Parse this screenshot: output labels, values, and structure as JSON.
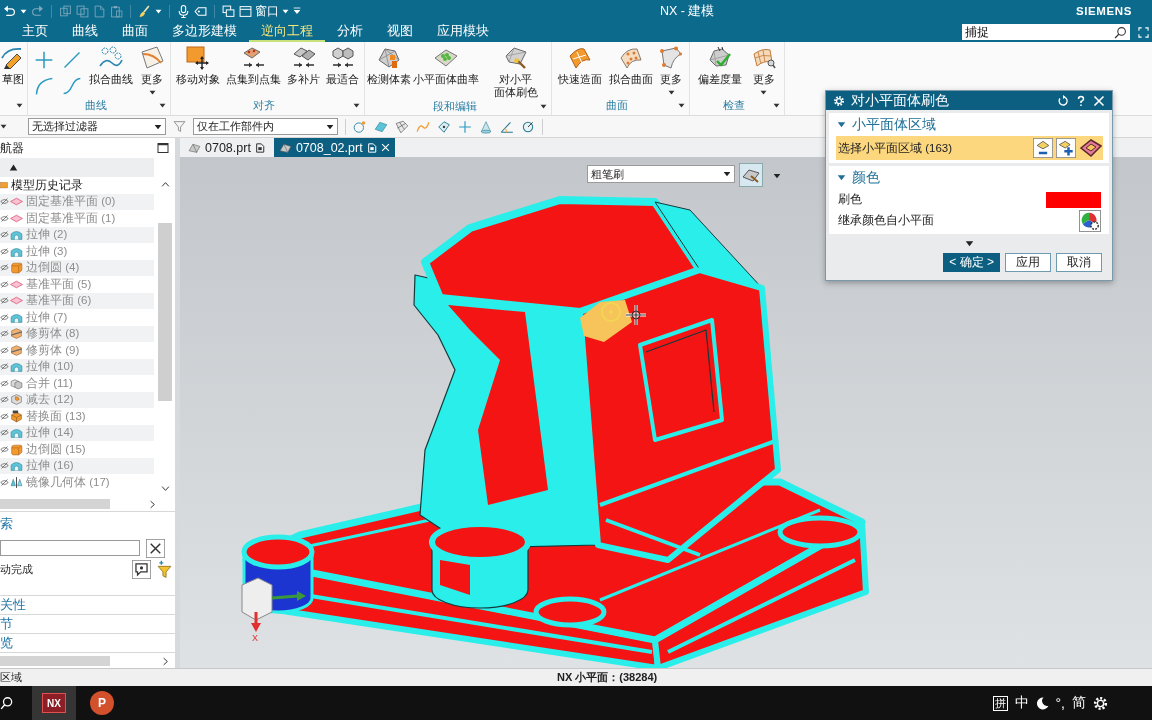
{
  "title_bar": {
    "window_menu": "窗口",
    "title": "NX - 建模",
    "brand": "SIEMENS"
  },
  "menu_tabs": [
    {
      "label": "主页",
      "selected": false
    },
    {
      "label": "曲线",
      "selected": false
    },
    {
      "label": "曲面",
      "selected": false
    },
    {
      "label": "多边形建模",
      "selected": false
    },
    {
      "label": "逆向工程",
      "selected": true
    },
    {
      "label": "分析",
      "selected": false
    },
    {
      "label": "视图",
      "selected": false
    },
    {
      "label": "应用模块",
      "selected": false
    }
  ],
  "command_search": {
    "value": "捕捉"
  },
  "ribbon": {
    "groups": [
      {
        "buttons": [
          {
            "kind": "large",
            "label": "草图"
          }
        ]
      },
      {
        "label": "曲线",
        "buttons": [
          {
            "kind": "lines"
          },
          {
            "kind": "large",
            "label": "拟合曲线"
          },
          {
            "kind": "more",
            "label": "更多"
          }
        ]
      },
      {
        "label": "对齐",
        "buttons": [
          {
            "kind": "large",
            "label": "移动对象"
          },
          {
            "kind": "large",
            "label": "点集到点集"
          },
          {
            "kind": "large",
            "label": "多补片"
          },
          {
            "kind": "large",
            "label": "最适合"
          }
        ]
      },
      {
        "label": "段和编辑",
        "buttons": [
          {
            "kind": "large",
            "label": "检测体素"
          },
          {
            "kind": "large",
            "label": "小平面体曲率"
          },
          {
            "kind": "large",
            "label": "对小平面体刷色"
          }
        ]
      },
      {
        "label": "曲面",
        "buttons": [
          {
            "kind": "large",
            "label": "快速造面"
          },
          {
            "kind": "large",
            "label": "拟合曲面"
          },
          {
            "kind": "more",
            "label": "更多"
          }
        ]
      },
      {
        "label": "检查",
        "buttons": [
          {
            "kind": "large",
            "label": "偏差度量"
          },
          {
            "kind": "more",
            "label": "更多"
          }
        ]
      }
    ]
  },
  "selection_bar": {
    "filter": "无选择过滤器",
    "scope": "仅在工作部件内"
  },
  "navigator": {
    "title": "航器",
    "root": {
      "label": "模型历史记录",
      "children": [
        {
          "kind": "datum",
          "label": "固定基准平面 (0)",
          "disabled": true
        },
        {
          "kind": "datum",
          "label": "固定基准平面 (1)",
          "disabled": true
        },
        {
          "kind": "extrude",
          "label": "拉伸 (2)",
          "disabled": true
        },
        {
          "kind": "extrude",
          "label": "拉伸 (3)",
          "disabled": true
        },
        {
          "kind": "blend",
          "label": "边倒圆 (4)",
          "disabled": true
        },
        {
          "kind": "datum",
          "label": "基准平面 (5)",
          "disabled": true
        },
        {
          "kind": "datum",
          "label": "基准平面 (6)",
          "disabled": true
        },
        {
          "kind": "extrude",
          "label": "拉伸 (7)",
          "disabled": true
        },
        {
          "kind": "trim",
          "label": "修剪体 (8)",
          "disabled": true
        },
        {
          "kind": "trim",
          "label": "修剪体 (9)",
          "disabled": true
        },
        {
          "kind": "extrude",
          "label": "拉伸 (10)",
          "disabled": true
        },
        {
          "kind": "unite",
          "label": "合并 (11)",
          "disabled": true
        },
        {
          "kind": "subtract",
          "label": "减去 (12)",
          "disabled": true
        },
        {
          "kind": "replace",
          "label": "替换面 (13)",
          "disabled": true
        },
        {
          "kind": "extrude",
          "label": "拉伸 (14)",
          "disabled": true
        },
        {
          "kind": "blend",
          "label": "边倒圆 (15)",
          "disabled": true
        },
        {
          "kind": "extrude",
          "label": "拉伸 (16)",
          "disabled": true
        },
        {
          "kind": "mirror",
          "label": "镜像几何体 (17)",
          "disabled": true
        }
      ]
    }
  },
  "search_panel": {
    "header": "索",
    "auto_complete": "动完成",
    "sections": [
      "关性",
      "节",
      "览"
    ]
  },
  "document_tabs": [
    {
      "label": "0708.prt",
      "selected": false
    },
    {
      "label": "0708_02.prt",
      "selected": true
    }
  ],
  "viewport": {
    "brush_type": "粗笔刷",
    "axis_label": "X"
  },
  "dialog": {
    "title": "对小平面体刷色",
    "sections": [
      {
        "label": "小平面体区域",
        "expanded": true,
        "rows": [
          {
            "kind": "selection",
            "label": "选择小平面区域 (163)",
            "selected": true
          }
        ]
      },
      {
        "label": "颜色",
        "expanded": true,
        "rows": [
          {
            "kind": "swatch",
            "label": "刷色",
            "color": "#ff0000"
          },
          {
            "kind": "inherit",
            "label": "继承颜色自小平面"
          }
        ]
      }
    ],
    "buttons": [
      {
        "kind": "primary",
        "label": "< 确定 >"
      },
      {
        "kind": "normal",
        "label": "应用"
      },
      {
        "kind": "normal",
        "label": "取消"
      }
    ]
  },
  "status_bar": {
    "prompt": "区域",
    "info": "NX 小平面：(38284)"
  },
  "taskbar": {
    "apps": [
      {
        "kind": "tile",
        "label": "NX",
        "selected": true
      },
      {
        "kind": "disc",
        "label": "P",
        "selected": false
      }
    ],
    "tray": [
      {
        "kind": "boxed",
        "label": "拼"
      },
      {
        "kind": "text",
        "label": "中"
      },
      {
        "kind": "moon"
      },
      {
        "kind": "text",
        "label": "°,"
      },
      {
        "kind": "text",
        "label": "简"
      },
      {
        "kind": "gear"
      }
    ]
  }
}
